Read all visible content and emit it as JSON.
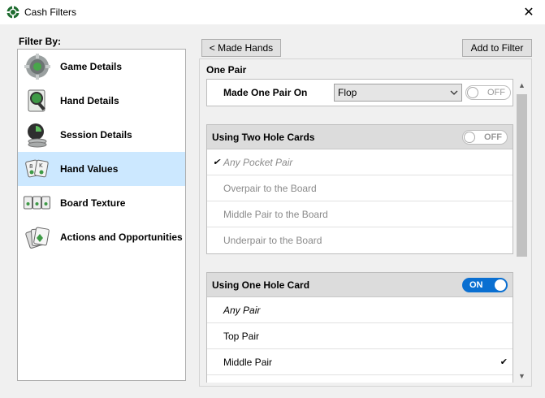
{
  "window": {
    "title": "Cash Filters",
    "close_glyph": "✕"
  },
  "sidebar": {
    "heading": "Filter By:",
    "items": [
      {
        "label": "Game Details",
        "icon": "gear-chip-icon",
        "active": false
      },
      {
        "label": "Hand Details",
        "icon": "magnifier-card-icon",
        "active": false
      },
      {
        "label": "Session Details",
        "icon": "clock-chips-icon",
        "active": false
      },
      {
        "label": "Hand Values",
        "icon": "cards-icon",
        "active": true
      },
      {
        "label": "Board Texture",
        "icon": "board-cards-icon",
        "active": false
      },
      {
        "label": "Actions and Opportunities",
        "icon": "stacked-cards-icon",
        "active": false
      }
    ]
  },
  "toolbar": {
    "back_label": "< Made Hands",
    "add_label": "Add to Filter"
  },
  "main": {
    "section_title": "One Pair",
    "made_on": {
      "label": "Made One Pair On",
      "selected": "Flop",
      "toggle": "OFF"
    },
    "two_hole": {
      "title": "Using Two Hole Cards",
      "toggle": "OFF",
      "items": [
        "Any Pocket Pair",
        "Overpair to the Board",
        "Middle Pair to the Board",
        "Underpair to the Board"
      ]
    },
    "one_hole": {
      "title": "Using One Hole Card",
      "toggle": "ON",
      "items": [
        "Any Pair",
        "Top Pair",
        "Middle Pair"
      ]
    }
  },
  "colors": {
    "active_item_bg": "#cce8ff",
    "toggle_on": "#0a6fd1"
  }
}
